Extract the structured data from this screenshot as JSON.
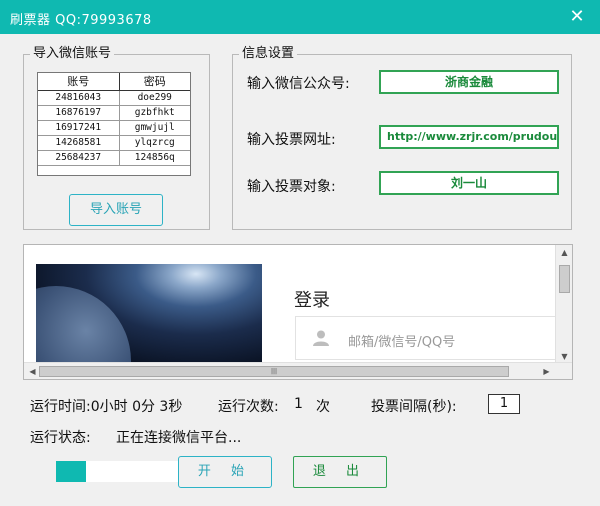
{
  "window": {
    "title": "刷票器  QQ:79993678",
    "close_glyph": "✕"
  },
  "import_group": {
    "legend": "导入微信账号",
    "columns": [
      "账号",
      "密码"
    ],
    "rows": [
      [
        "24816043",
        "doe299"
      ],
      [
        "16876197",
        "gzbfhkt"
      ],
      [
        "16917241",
        "gmwjujl"
      ],
      [
        "14268581",
        "ylqzrcg"
      ],
      [
        "25684237",
        "124856q"
      ]
    ],
    "button_label": "导入账号"
  },
  "info_group": {
    "legend": "信息设置",
    "fields": [
      {
        "label": "输入微信公众号:",
        "value": "浙商金融"
      },
      {
        "label": "输入投票网址:",
        "value": "http://www.zrjr.com/prudouc/a"
      },
      {
        "label": "输入投票对象:",
        "value": "刘一山"
      }
    ]
  },
  "browser": {
    "login_title": "登录",
    "login_placeholder": "邮箱/微信号/QQ号",
    "hscroll_grip": "|||"
  },
  "status": {
    "runtime": "运行时间:0小时 0分 3秒",
    "run_count_label": "运行次数:",
    "run_count_value": "1",
    "run_count_unit": "次",
    "interval_label": "投票间隔(秒):",
    "interval_value": "1",
    "state_label": "运行状态:",
    "state_value": "正在连接微信平台..."
  },
  "progress": {
    "percent": 25
  },
  "controls": {
    "start_label": "开 始",
    "exit_label": "退 出"
  },
  "colors": {
    "accent": "#0fb9b1",
    "green": "#31a354"
  }
}
